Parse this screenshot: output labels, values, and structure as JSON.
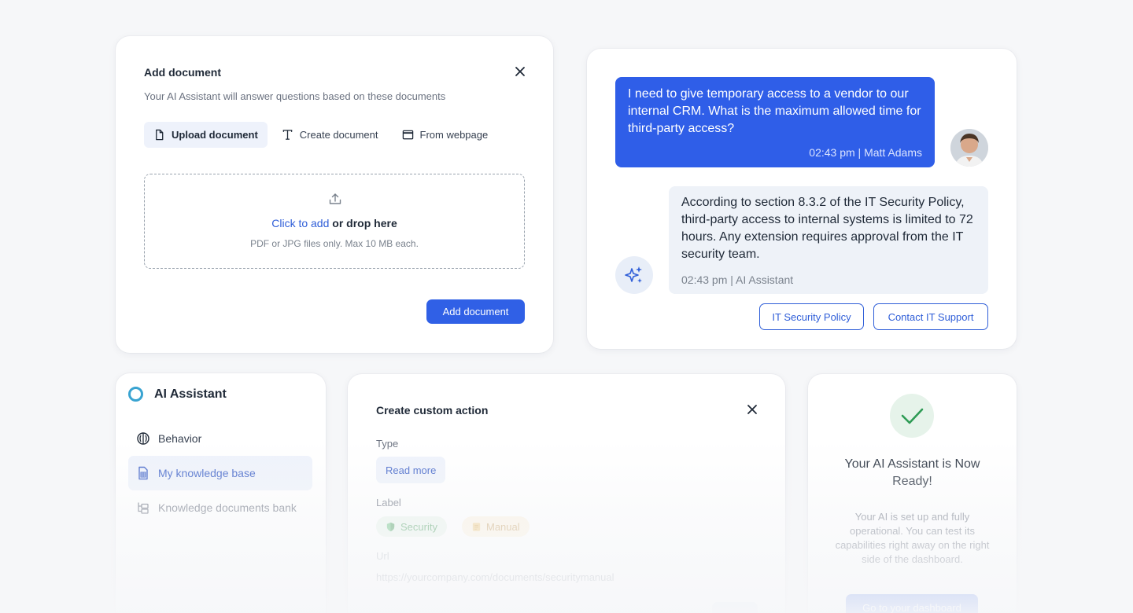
{
  "add_document": {
    "title": "Add document",
    "subtitle": "Your AI Assistant will answer questions based on these documents",
    "tabs": [
      {
        "label": "Upload document",
        "icon": "file-icon",
        "active": true
      },
      {
        "label": "Create document",
        "icon": "text-icon",
        "active": false
      },
      {
        "label": "From webpage",
        "icon": "browser-icon",
        "active": false
      }
    ],
    "dropzone": {
      "link_text": "Click to add",
      "rest_text": " or drop here",
      "hint": "PDF or JPG files only. Max 10 MB each."
    },
    "submit_label": "Add document"
  },
  "chat": {
    "user_message": "I need to give temporary access to a vendor to our internal CRM. What is the maximum allowed time for third-party access?",
    "user_meta": "02:43 pm | Matt Adams",
    "ai_message": "According to section 8.3.2 of the IT Security Policy, third-party access to internal systems is limited to 72 hours. Any extension requires approval from the IT security team.",
    "ai_meta": "02:43 pm | AI Assistant",
    "actions": [
      "IT Security Policy",
      "Contact IT Support"
    ]
  },
  "sidebar": {
    "brand": "AI Assistant",
    "items": [
      {
        "label": "Behavior",
        "icon": "brain-icon"
      },
      {
        "label": "My knowledge base",
        "icon": "spreadsheet-icon",
        "active": true
      },
      {
        "label": "Knowledge documents bank",
        "icon": "folder-tree-icon"
      }
    ]
  },
  "custom_action": {
    "title": "Create custom action",
    "type_label": "Type",
    "type_value": "Read more",
    "label_label": "Label",
    "tags": [
      {
        "label": "Security",
        "icon": "shield-icon"
      },
      {
        "label": "Manual",
        "icon": "note-icon"
      }
    ],
    "url_label": "Url",
    "url_value": "https://yourcompany.com/documents/securitymanual"
  },
  "ready": {
    "title": "Your AI Assistant is Now Ready!",
    "description": "Your AI is set up and fully operational. You can test its capabilities right away on the right side of the dashboard.",
    "button_label": "Go to your dashboard"
  },
  "colors": {
    "primary": "#3060e6",
    "accent_light": "#eef2fb",
    "success": "#2e9b55",
    "brand_ring": "#38a3d1"
  }
}
